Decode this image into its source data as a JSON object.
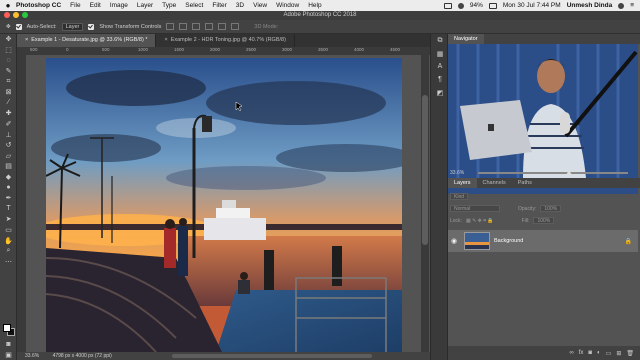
{
  "menubar": {
    "app_name": "Photoshop CC",
    "items": [
      "File",
      "Edit",
      "Image",
      "Layer",
      "Type",
      "Select",
      "Filter",
      "3D",
      "View",
      "Window",
      "Help"
    ],
    "battery": "94%",
    "clock": "Mon 30 Jul  7:44 PM",
    "user": "Unmesh Dinda"
  },
  "window": {
    "title": "Adobe Photoshop CC 2018"
  },
  "options": {
    "auto_select_label": "Auto-Select:",
    "auto_select_value": "Layer",
    "transform_label": "Show Transform Controls",
    "mode_3d": "3D Mode:"
  },
  "tabs": [
    {
      "label": "Example 1 - Desaturate.jpg @ 33.6% (RGB/8) *"
    },
    {
      "label": "Example 2 - HDR Toning.jpg @ 40.7% (RGB/8)"
    }
  ],
  "ruler": [
    "500",
    "0",
    "500",
    "1000",
    "1500",
    "2000",
    "2500",
    "3000",
    "3500",
    "4000",
    "4500"
  ],
  "status": {
    "zoom": "33.6%",
    "doc_size": "4798 px x 4000 px (72 ppi)"
  },
  "navigator": {
    "tab": "Navigator",
    "zoom": "33.6%"
  },
  "layers": {
    "tabs": [
      "Layers",
      "Channels",
      "Paths"
    ],
    "kind": "Kind",
    "blend": "Normal",
    "opacity_label": "Opacity:",
    "opacity": "100%",
    "lock_label": "Lock:",
    "fill_label": "Fill:",
    "fill": "100%",
    "layer_name": "Background"
  },
  "colors": {
    "accent": "#4a8cd8",
    "panel_bg": "#535353"
  }
}
